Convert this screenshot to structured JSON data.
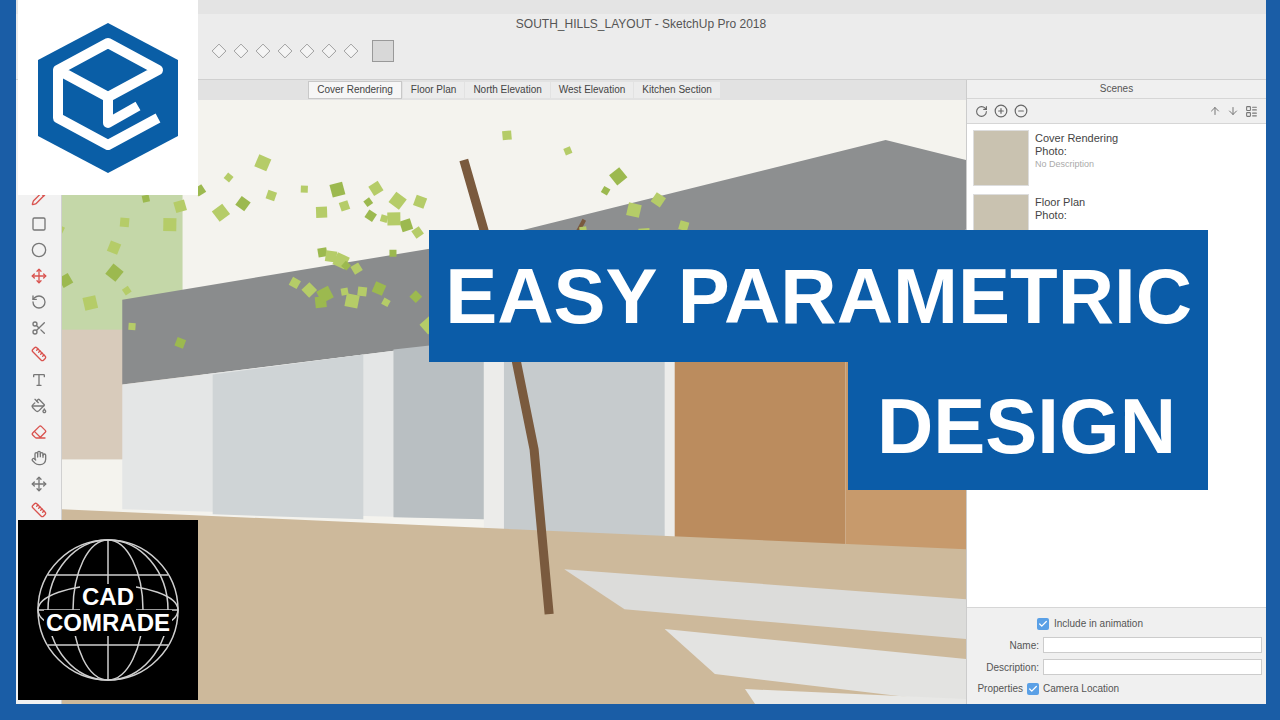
{
  "window": {
    "title": "SOUTH_HILLS_LAYOUT - SketchUp Pro 2018"
  },
  "scene_tabs": [
    {
      "label": "Cover Rendering",
      "selected": true
    },
    {
      "label": "Floor Plan",
      "selected": false
    },
    {
      "label": "North Elevation",
      "selected": false
    },
    {
      "label": "West Elevation",
      "selected": false
    },
    {
      "label": "Kitchen Section",
      "selected": false
    }
  ],
  "scenes_panel": {
    "title": "Scenes",
    "items": [
      {
        "name": "Cover Rendering",
        "photo_label": "Photo:",
        "description": "No Description"
      },
      {
        "name": "Floor Plan",
        "photo_label": "Photo:",
        "description": ""
      }
    ],
    "include_in_animation": {
      "label": "Include in animation",
      "checked": true
    },
    "fields": [
      {
        "label": "Name:",
        "value": ""
      },
      {
        "label": "Description:",
        "value": ""
      }
    ],
    "properties": {
      "label": "Properties",
      "options": [
        {
          "label": "Camera Location",
          "checked": true
        }
      ]
    }
  },
  "overlay": {
    "banner_lines": [
      "EASY PARAMETRIC",
      "DESIGN"
    ],
    "badge_lines": [
      "CAD",
      "COMRADE"
    ]
  }
}
